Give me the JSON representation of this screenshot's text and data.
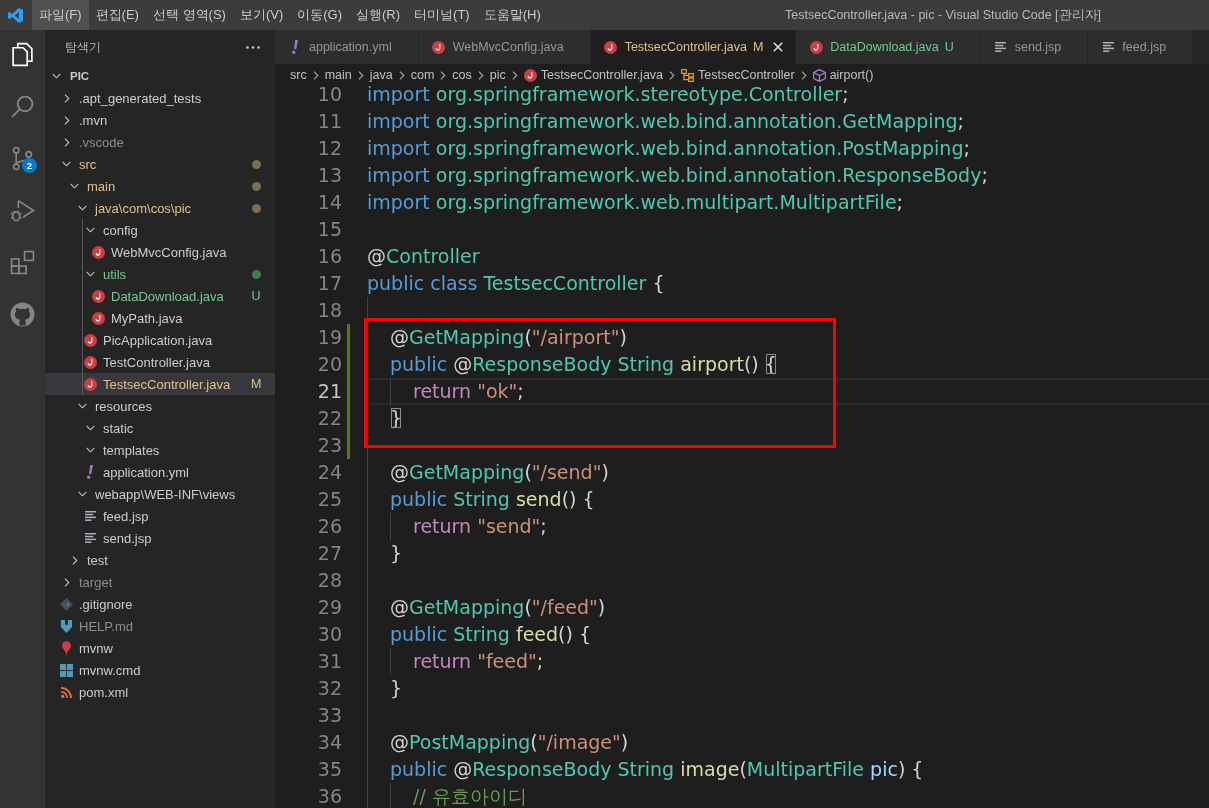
{
  "titlebar": {
    "menu": [
      {
        "label": "파일(F)",
        "selected": true
      },
      {
        "label": "편집(E)",
        "selected": false
      },
      {
        "label": "선택 영역(S)",
        "selected": false
      },
      {
        "label": "보기(V)",
        "selected": false
      },
      {
        "label": "이동(G)",
        "selected": false
      },
      {
        "label": "실행(R)",
        "selected": false
      },
      {
        "label": "터미널(T)",
        "selected": false
      },
      {
        "label": "도움말(H)",
        "selected": false
      }
    ],
    "title": "TestsecController.java - pic - Visual Studio Code [관리자]"
  },
  "activity_bar": [
    {
      "kind": "explorer",
      "selected": true
    },
    {
      "kind": "search",
      "selected": false
    },
    {
      "kind": "source-control",
      "selected": false,
      "badge": "2"
    },
    {
      "kind": "run",
      "selected": false
    },
    {
      "kind": "extensions",
      "selected": false
    },
    {
      "kind": "github",
      "selected": false
    }
  ],
  "sidebar": {
    "title": "탐색기",
    "tree": {
      "label": "PIC",
      "expanded": true,
      "children": [
        {
          "label": ".apt_generated_tests",
          "kind": "folder",
          "expanded": false,
          "selected": false,
          "modified": false,
          "untracked": false,
          "ignored": false
        },
        {
          "label": ".mvn",
          "kind": "folder",
          "expanded": false,
          "selected": false,
          "modified": false,
          "untracked": false,
          "ignored": false
        },
        {
          "label": ".vscode",
          "kind": "folder",
          "expanded": false,
          "selected": false,
          "modified": false,
          "untracked": false,
          "ignored": true
        },
        {
          "label": "src",
          "kind": "folder",
          "expanded": true,
          "selected": false,
          "modified": true,
          "untracked": false,
          "ignored": false,
          "children": [
            {
              "label": "main",
              "kind": "folder",
              "expanded": true,
              "selected": false,
              "modified": true,
              "untracked": false,
              "ignored": false,
              "children": [
                {
                  "label": "java\\com\\cos\\pic",
                  "kind": "folder",
                  "expanded": true,
                  "selected": false,
                  "modified": true,
                  "untracked": false,
                  "ignored": false,
                  "children": [
                    {
                      "label": "config",
                      "kind": "folder",
                      "expanded": true,
                      "selected": false,
                      "modified": false,
                      "untracked": false,
                      "ignored": false,
                      "children": [
                        {
                          "label": "WebMvcConfig.java",
                          "kind": "java",
                          "selected": false,
                          "modified": false,
                          "untracked": false,
                          "ignored": false
                        }
                      ]
                    },
                    {
                      "label": "utils",
                      "kind": "folder",
                      "expanded": true,
                      "selected": false,
                      "modified": false,
                      "untracked": true,
                      "ignored": false,
                      "children": [
                        {
                          "label": "DataDownload.java",
                          "kind": "java",
                          "selected": false,
                          "modified": false,
                          "untracked": true,
                          "ignored": false,
                          "badge": "U"
                        },
                        {
                          "label": "MyPath.java",
                          "kind": "java",
                          "selected": false,
                          "modified": false,
                          "untracked": false,
                          "ignored": false
                        }
                      ]
                    },
                    {
                      "label": "PicApplication.java",
                      "kind": "java",
                      "selected": false,
                      "modified": false,
                      "untracked": false,
                      "ignored": false
                    },
                    {
                      "label": "TestController.java",
                      "kind": "java",
                      "selected": false,
                      "modified": false,
                      "untracked": false,
                      "ignored": false
                    },
                    {
                      "label": "TestsecController.java",
                      "kind": "java",
                      "selected": true,
                      "modified": true,
                      "untracked": false,
                      "ignored": false,
                      "badge": "M"
                    }
                  ]
                },
                {
                  "label": "resources",
                  "kind": "folder",
                  "expanded": true,
                  "selected": false,
                  "modified": false,
                  "untracked": false,
                  "ignored": false,
                  "children": [
                    {
                      "label": "static",
                      "kind": "folder",
                      "expanded": true,
                      "selected": false,
                      "modified": false,
                      "untracked": false,
                      "ignored": false
                    },
                    {
                      "label": "templates",
                      "kind": "folder",
                      "expanded": true,
                      "selected": false,
                      "modified": false,
                      "untracked": false,
                      "ignored": false
                    },
                    {
                      "label": "application.yml",
                      "kind": "yaml",
                      "selected": false,
                      "modified": false,
                      "untracked": false,
                      "ignored": false
                    }
                  ]
                },
                {
                  "label": "webapp\\WEB-INF\\views",
                  "kind": "folder",
                  "expanded": true,
                  "selected": false,
                  "modified": false,
                  "untracked": false,
                  "ignored": false,
                  "children": [
                    {
                      "label": "feed.jsp",
                      "kind": "jsp",
                      "selected": false,
                      "modified": false,
                      "untracked": false,
                      "ignored": false
                    },
                    {
                      "label": "send.jsp",
                      "kind": "jsp",
                      "selected": false,
                      "modified": false,
                      "untracked": false,
                      "ignored": false
                    }
                  ]
                }
              ]
            },
            {
              "label": "test",
              "kind": "folder",
              "expanded": false,
              "selected": false,
              "modified": false,
              "untracked": false,
              "ignored": false
            }
          ]
        },
        {
          "label": "target",
          "kind": "folder",
          "expanded": false,
          "selected": false,
          "modified": false,
          "untracked": false,
          "ignored": true
        },
        {
          "label": ".gitignore",
          "kind": "gitignore",
          "selected": false,
          "modified": false,
          "untracked": false,
          "ignored": false
        },
        {
          "label": "HELP.md",
          "kind": "markdown",
          "selected": false,
          "modified": false,
          "untracked": false,
          "ignored": true
        },
        {
          "label": "mvnw",
          "kind": "shell",
          "selected": false,
          "modified": false,
          "untracked": false,
          "ignored": false
        },
        {
          "label": "mvnw.cmd",
          "kind": "cmd",
          "selected": false,
          "modified": false,
          "untracked": false,
          "ignored": false
        },
        {
          "label": "pom.xml",
          "kind": "xml",
          "selected": false,
          "modified": false,
          "untracked": false,
          "ignored": false
        }
      ]
    }
  },
  "editor": {
    "tabs": [
      {
        "label": "application.yml",
        "kind": "yaml",
        "selected": false,
        "modified": false,
        "untracked": false
      },
      {
        "label": "WebMvcConfig.java",
        "kind": "java",
        "selected": false,
        "modified": false,
        "untracked": false
      },
      {
        "label": "TestsecController.java",
        "kind": "java",
        "selected": true,
        "modified": true,
        "untracked": false,
        "badge": "M"
      },
      {
        "label": "DataDownload.java",
        "kind": "java",
        "selected": false,
        "modified": false,
        "untracked": true,
        "badge": "U"
      },
      {
        "label": "send.jsp",
        "kind": "jsp",
        "selected": false,
        "modified": false,
        "untracked": false
      },
      {
        "label": "feed.jsp",
        "kind": "jsp",
        "selected": false,
        "modified": false,
        "untracked": false
      }
    ],
    "breadcrumb": [
      {
        "label": "src",
        "kind": "folder"
      },
      {
        "label": "main",
        "kind": "folder"
      },
      {
        "label": "java",
        "kind": "folder"
      },
      {
        "label": "com",
        "kind": "folder"
      },
      {
        "label": "cos",
        "kind": "folder"
      },
      {
        "label": "pic",
        "kind": "folder"
      },
      {
        "label": "TestsecController.java",
        "kind": "java"
      },
      {
        "label": "TestsecController",
        "kind": "class"
      },
      {
        "label": "airport()",
        "kind": "method"
      }
    ],
    "lines": [
      {
        "number": "10",
        "current": false,
        "boxed": false,
        "added": false,
        "tokens": [
          {
            "kind": "keyword",
            "text": "import "
          },
          {
            "kind": "type",
            "text": "org.springframework.stereotype.Controller"
          },
          {
            "kind": "plain",
            "text": ";"
          }
        ]
      },
      {
        "number": "11",
        "current": false,
        "boxed": false,
        "added": false,
        "tokens": [
          {
            "kind": "keyword",
            "text": "import "
          },
          {
            "kind": "type",
            "text": "org.springframework.web.bind.annotation.GetMapping"
          },
          {
            "kind": "plain",
            "text": ";"
          }
        ]
      },
      {
        "number": "12",
        "current": false,
        "boxed": false,
        "added": false,
        "tokens": [
          {
            "kind": "keyword",
            "text": "import "
          },
          {
            "kind": "type",
            "text": "org.springframework.web.bind.annotation.PostMapping"
          },
          {
            "kind": "plain",
            "text": ";"
          }
        ]
      },
      {
        "number": "13",
        "current": false,
        "boxed": false,
        "added": false,
        "tokens": [
          {
            "kind": "keyword",
            "text": "import "
          },
          {
            "kind": "type",
            "text": "org.springframework.web.bind.annotation.ResponseBody"
          },
          {
            "kind": "plain",
            "text": ";"
          }
        ]
      },
      {
        "number": "14",
        "current": false,
        "boxed": false,
        "added": false,
        "tokens": [
          {
            "kind": "keyword",
            "text": "import "
          },
          {
            "kind": "type",
            "text": "org.springframework.web.multipart.MultipartFile"
          },
          {
            "kind": "plain",
            "text": ";"
          }
        ]
      },
      {
        "number": "15",
        "current": false,
        "boxed": false,
        "added": false
      },
      {
        "number": "16",
        "current": false,
        "boxed": false,
        "added": false,
        "tokens": [
          {
            "kind": "plain",
            "text": "@"
          },
          {
            "kind": "type",
            "text": "Controller"
          }
        ]
      },
      {
        "number": "17",
        "current": false,
        "boxed": false,
        "added": false,
        "tokens": [
          {
            "kind": "keyword",
            "text": "public class "
          },
          {
            "kind": "type",
            "text": "TestsecController"
          },
          {
            "kind": "plain",
            "text": " {"
          }
        ],
        "children": [
          {
            "number": "18",
            "current": false,
            "boxed": false,
            "added": false
          },
          {
            "number": "19",
            "current": false,
            "boxed": true,
            "added": true,
            "tokens": [
              {
                "kind": "plain",
                "text": "@"
              },
              {
                "kind": "type",
                "text": "GetMapping"
              },
              {
                "kind": "plain",
                "text": "("
              },
              {
                "kind": "string",
                "text": "\"/airport\""
              },
              {
                "kind": "plain",
                "text": ")"
              }
            ]
          },
          {
            "number": "20",
            "current": false,
            "boxed": true,
            "added": true,
            "tokens": [
              {
                "kind": "keyword",
                "text": "public "
              },
              {
                "kind": "plain",
                "text": "@"
              },
              {
                "kind": "type",
                "text": "ResponseBody String "
              },
              {
                "kind": "function",
                "text": "airport"
              },
              {
                "kind": "plain",
                "text": "() "
              },
              {
                "kind": "matched-bracket",
                "text": "{"
              }
            ],
            "children": [
              {
                "number": "21",
                "current": true,
                "boxed": true,
                "added": true,
                "tokens": [
                  {
                    "kind": "control",
                    "text": "return "
                  },
                  {
                    "kind": "string",
                    "text": "\"ok\""
                  },
                  {
                    "kind": "plain",
                    "text": ";"
                  }
                ]
              }
            ]
          },
          {
            "number": "22",
            "current": false,
            "boxed": true,
            "added": true,
            "tokens": [
              {
                "kind": "matched-bracket",
                "text": "}"
              }
            ]
          },
          {
            "number": "23",
            "current": false,
            "boxed": true,
            "added": true
          },
          {
            "number": "24",
            "current": false,
            "boxed": false,
            "added": false,
            "tokens": [
              {
                "kind": "plain",
                "text": "@"
              },
              {
                "kind": "type",
                "text": "GetMapping"
              },
              {
                "kind": "plain",
                "text": "("
              },
              {
                "kind": "string",
                "text": "\"/send\""
              },
              {
                "kind": "plain",
                "text": ")"
              }
            ]
          },
          {
            "number": "25",
            "current": false,
            "boxed": false,
            "added": false,
            "tokens": [
              {
                "kind": "keyword",
                "text": "public "
              },
              {
                "kind": "type",
                "text": "String "
              },
              {
                "kind": "function",
                "text": "send"
              },
              {
                "kind": "plain",
                "text": "() {"
              }
            ],
            "children": [
              {
                "number": "26",
                "current": false,
                "boxed": false,
                "added": false,
                "tokens": [
                  {
                    "kind": "control",
                    "text": "return "
                  },
                  {
                    "kind": "string",
                    "text": "\"send\""
                  },
                  {
                    "kind": "plain",
                    "text": ";"
                  }
                ]
              }
            ]
          },
          {
            "number": "27",
            "current": false,
            "boxed": false,
            "added": false,
            "tokens": [
              {
                "kind": "plain",
                "text": "}"
              }
            ]
          },
          {
            "number": "28",
            "current": false,
            "boxed": false,
            "added": false
          },
          {
            "number": "29",
            "current": false,
            "boxed": false,
            "added": false,
            "tokens": [
              {
                "kind": "plain",
                "text": "@"
              },
              {
                "kind": "type",
                "text": "GetMapping"
              },
              {
                "kind": "plain",
                "text": "("
              },
              {
                "kind": "string",
                "text": "\"/feed\""
              },
              {
                "kind": "plain",
                "text": ")"
              }
            ]
          },
          {
            "number": "30",
            "current": false,
            "boxed": false,
            "added": false,
            "tokens": [
              {
                "kind": "keyword",
                "text": "public "
              },
              {
                "kind": "type",
                "text": "String "
              },
              {
                "kind": "function",
                "text": "feed"
              },
              {
                "kind": "plain",
                "text": "() {"
              }
            ],
            "children": [
              {
                "number": "31",
                "current": false,
                "boxed": false,
                "added": false,
                "tokens": [
                  {
                    "kind": "control",
                    "text": "return "
                  },
                  {
                    "kind": "string",
                    "text": "\"feed\""
                  },
                  {
                    "kind": "plain",
                    "text": ";"
                  }
                ]
              }
            ]
          },
          {
            "number": "32",
            "current": false,
            "boxed": false,
            "added": false,
            "tokens": [
              {
                "kind": "plain",
                "text": "}"
              }
            ]
          },
          {
            "number": "33",
            "current": false,
            "boxed": false,
            "added": false
          },
          {
            "number": "34",
            "current": false,
            "boxed": false,
            "added": false,
            "tokens": [
              {
                "kind": "plain",
                "text": "@"
              },
              {
                "kind": "type",
                "text": "PostMapping"
              },
              {
                "kind": "plain",
                "text": "("
              },
              {
                "kind": "string",
                "text": "\"/image\""
              },
              {
                "kind": "plain",
                "text": ")"
              }
            ]
          },
          {
            "number": "35",
            "current": false,
            "boxed": false,
            "added": false,
            "tokens": [
              {
                "kind": "keyword",
                "text": "public "
              },
              {
                "kind": "plain",
                "text": "@"
              },
              {
                "kind": "type",
                "text": "ResponseBody String "
              },
              {
                "kind": "function",
                "text": "image"
              },
              {
                "kind": "plain",
                "text": "("
              },
              {
                "kind": "type",
                "text": "MultipartFile "
              },
              {
                "kind": "variable",
                "text": "pic"
              },
              {
                "kind": "plain",
                "text": ") {"
              }
            ],
            "children": [
              {
                "number": "36",
                "current": false,
                "boxed": false,
                "added": false,
                "tokens": [
                  {
                    "kind": "comment",
                    "text": "// 유효아이디"
                  }
                ]
              }
            ]
          }
        ]
      }
    ]
  }
}
